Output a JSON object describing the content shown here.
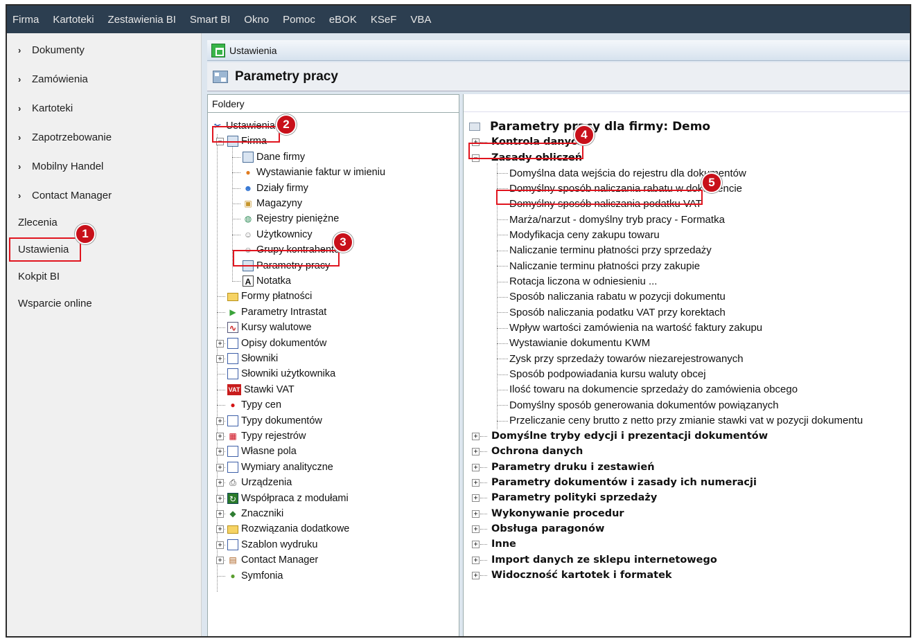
{
  "menu": [
    "Firma",
    "Kartoteki",
    "Zestawienia BI",
    "Smart BI",
    "Okno",
    "Pomoc",
    "eBOK",
    "KSeF",
    "VBA"
  ],
  "sidebar": {
    "expandable": [
      "Dokumenty",
      "Zamówienia",
      "Kartoteki",
      "Zapotrzebowanie",
      "Mobilny Handel",
      "Contact Manager"
    ],
    "plain": [
      "Zlecenia",
      "Ustawienia",
      "Kokpit BI",
      "Wsparcie online"
    ]
  },
  "window": {
    "title": "Ustawienia",
    "header": "Parametry pracy"
  },
  "left_pane": {
    "header": "Foldery",
    "root": "Ustawienia",
    "firma": "Firma",
    "firma_children": [
      "Dane firmy",
      "Wystawianie faktur w imieniu",
      "Działy firmy",
      "Magazyny",
      "Rejestry pieniężne",
      "Użytkownicy",
      "Grupy kontrahentów",
      "Parametry pracy",
      "Notatka"
    ],
    "others": [
      "Formy płatności",
      "Parametry Intrastat",
      "Kursy walutowe",
      "Opisy dokumentów",
      "Słowniki",
      "Słowniki użytkownika",
      "Stawki VAT",
      "Typy cen",
      "Typy dokumentów",
      "Typy rejestrów",
      "Własne pola",
      "Wymiary analityczne",
      "Urządzenia",
      "Współpraca z modułami",
      "Znaczniki",
      "Rozwiązania dodatkowe",
      "Szablon wydruku",
      "Contact Manager",
      "Symfonia"
    ]
  },
  "right_pane": {
    "title": "Parametry pracy dla firmy: Demo",
    "kontrola": "Kontrola danych",
    "zasady": "Zasady obliczeń",
    "zasady_children": [
      "Domyślna data wejścia do rejestru dla dokumentów",
      "Domyślny sposób naliczania rabatu w dokumencie",
      "Domyślny sposób naliczania podatku VAT",
      "Marża/narzut - domyślny tryb pracy - Formatka",
      "Modyfikacja ceny zakupu towaru",
      "Naliczanie terminu płatności przy sprzedaży",
      "Naliczanie terminu płatności przy zakupie",
      "Rotacja liczona w odniesieniu ...",
      "Sposób naliczania rabatu w pozycji dokumentu",
      "Sposób naliczania podatku VAT przy korektach",
      "Wpływ wartości zamówienia na wartość faktury zakupu",
      "Wystawianie dokumentu KWM",
      "Zysk przy sprzedaży towarów niezarejestrowanych",
      "Sposób podpowiadania kursu waluty obcej",
      "Ilość towaru na dokumencie sprzedaży do zamówienia obcego",
      "Domyślny sposób generowania dokumentów powiązanych",
      "Przeliczanie ceny brutto z netto przy zmianie stawki vat w pozycji dokumentu"
    ],
    "groups": [
      "Domyślne tryby edycji i prezentacji dokumentów",
      "Ochrona danych",
      "Parametry druku i zestawień",
      "Parametry dokumentów i zasady ich numeracji",
      "Parametry polityki sprzedaży",
      "Wykonywanie procedur",
      "Obsługa paragonów",
      "Inne",
      "Import danych ze sklepu internetowego",
      "Widoczność kartotek i formatek"
    ]
  },
  "badges": [
    "1",
    "2",
    "3",
    "4",
    "5"
  ],
  "colors": {
    "menubar": "#2c3e50",
    "highlight": "#e0141e",
    "badge": "#c8101a"
  }
}
